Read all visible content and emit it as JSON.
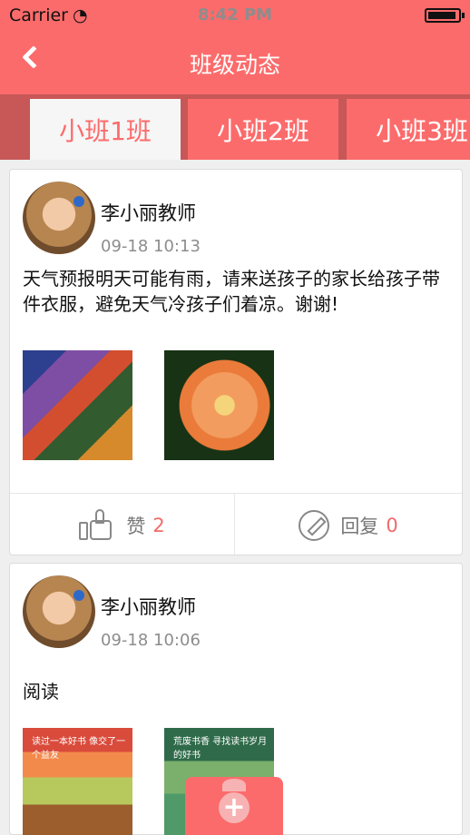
{
  "status": {
    "carrier": "Carrier",
    "time": "8:42 PM"
  },
  "nav": {
    "title": "班级动态"
  },
  "tabs": [
    {
      "label": "小班1班"
    },
    {
      "label": "小班2班"
    },
    {
      "label": "小班3班"
    }
  ],
  "posts": [
    {
      "author": "李小丽教师",
      "time": "09-18 10:13",
      "text": "天气预报明天可能有雨，请来送孩子的家长给孩子带件衣服，避免天气冷孩子们着凉。谢谢!",
      "like_label": "赞",
      "like_count": "2",
      "reply_label": "回复",
      "reply_count": "0"
    },
    {
      "author": "李小丽教师",
      "time": "09-18 10:06",
      "text": "阅读"
    }
  ],
  "thumb_texts": {
    "left": "读过一本好书 像交了一个益友",
    "right": "荒废书香 寻找读书岁月的好书"
  },
  "colors": {
    "accent": "#fc6b6b",
    "tab_bg": "#c85757"
  }
}
